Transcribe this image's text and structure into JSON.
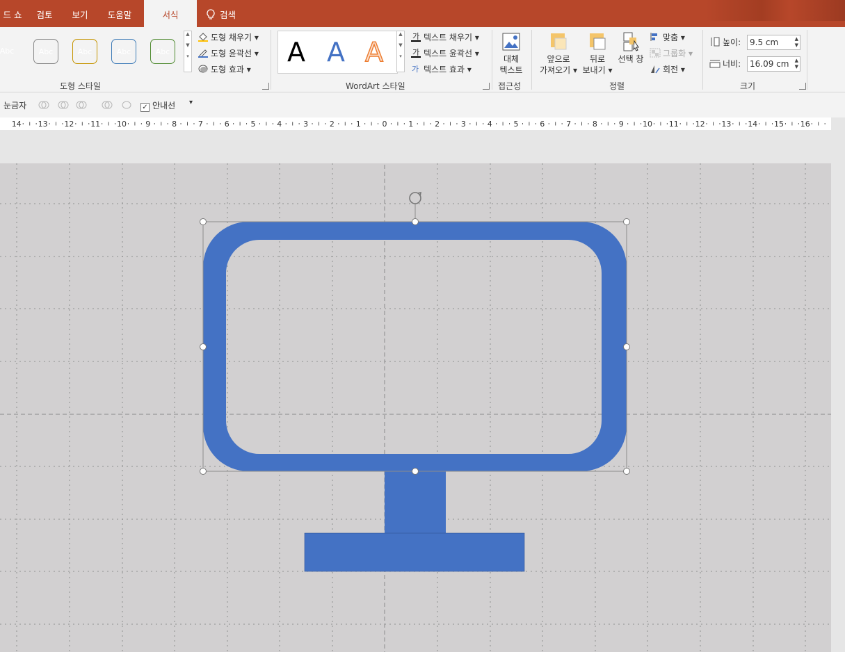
{
  "tabs": [
    "드 쇼",
    "검토",
    "보기",
    "도움말",
    "서식"
  ],
  "active_tab": "서식",
  "search": {
    "label": "검색",
    "icon": "lightbulb-icon"
  },
  "shape_styles": {
    "swatches": [
      {
        "label": "Abc",
        "color": "#ed7d31"
      },
      {
        "label": "Abc",
        "color": "#a5a5a5"
      },
      {
        "label": "Abc",
        "color": "#ffc000"
      },
      {
        "label": "Abc",
        "color": "#5b9bd5"
      },
      {
        "label": "Abc",
        "color": "#70ad47"
      }
    ],
    "fill_label": "도형 채우기",
    "outline_label": "도형 윤곽선",
    "effects_label": "도형 효과",
    "group_label": "도형 스타일"
  },
  "wordart": {
    "letters": [
      {
        "label": "A",
        "color": "#000000"
      },
      {
        "label": "A",
        "color": "#4472c4"
      },
      {
        "label": "A",
        "color": "#ed7d31"
      }
    ],
    "fill_label": "텍스트 채우기",
    "outline_label": "텍스트 윤곽선",
    "effects_label": "텍스트 효과",
    "group_label": "WordArt 스타일"
  },
  "accessibility": {
    "alt_text_line1": "대체",
    "alt_text_line2": "텍스트",
    "group_label": "접근성"
  },
  "arrange": {
    "bring_forward_line1": "앞으로",
    "bring_forward_line2": "가져오기",
    "send_backward_line1": "뒤로",
    "send_backward_line2": "보내기",
    "selection_pane": "선택 창",
    "align": "맞춤",
    "group": "그룹화",
    "rotate": "회전",
    "group_label": "정렬"
  },
  "size": {
    "height_label": "높이:",
    "height_value": "9.5 cm",
    "width_label": "너비:",
    "width_value": "16.09 cm",
    "group_label": "크기"
  },
  "toolbar2": {
    "gridlines_label": "눈금자",
    "guides_label": "안내선",
    "guides_checked": true
  },
  "ruler": {
    "ticks": [
      "14",
      "13",
      "12",
      "11",
      "10",
      "9",
      "8",
      "7",
      "6",
      "5",
      "4",
      "3",
      "2",
      "1",
      "0",
      "1",
      "2",
      "3",
      "4",
      "5",
      "6",
      "7",
      "8",
      "9",
      "10",
      "11",
      "12",
      "13",
      "14",
      "15",
      "16"
    ]
  },
  "colors": {
    "tab_bar": "#b7472a",
    "shape_fill": "#4472c4",
    "slide_bg": "#d2d0d1"
  }
}
